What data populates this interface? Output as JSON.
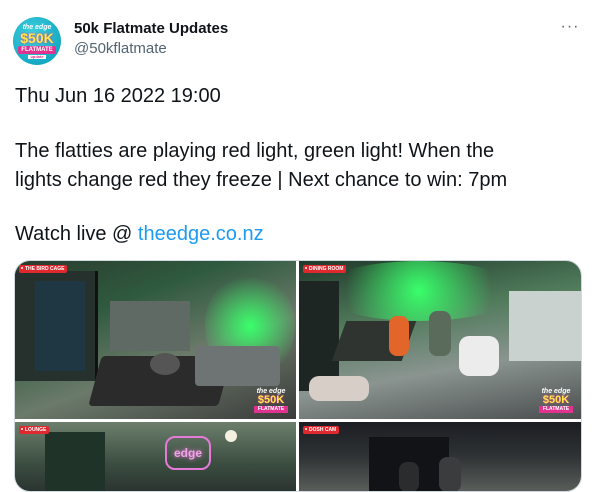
{
  "author": {
    "name": "50k Flatmate Updates",
    "handle": "@50kflatmate"
  },
  "avatar_text": {
    "top": "the edge",
    "big": "$50K",
    "banner": "FLATMATE",
    "small": "update"
  },
  "more_label": "···",
  "tweet": {
    "timestamp_line": "Thu Jun 16 2022 19:00",
    "body_line1": "The flatties are playing red light, green light! When the",
    "body_line2": "lights change red they freeze | Next chance to win: 7pm",
    "watch_prefix": "Watch live @ ",
    "watch_link": "theedge.co.nz"
  },
  "media": {
    "tiles": [
      {
        "label": "THE BIRD CAGE"
      },
      {
        "label": "DINING ROOM"
      },
      {
        "label": "LOUNGE"
      },
      {
        "label": "DOSH CAM"
      }
    ],
    "watermark": {
      "top": "the edge",
      "big": "$50K",
      "banner": "FLATMATE"
    },
    "neon_sign": "edge"
  }
}
